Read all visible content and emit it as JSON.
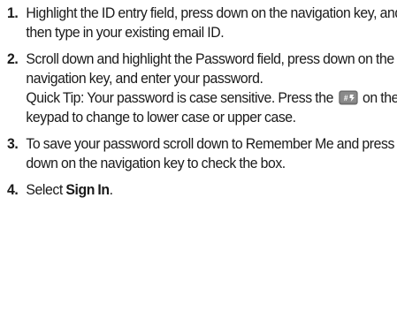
{
  "steps": [
    {
      "number": "1.",
      "text": "Highlight the ID entry field, press down on the navigation key, and then type in your existing email ID."
    },
    {
      "number": "2.",
      "text": "Scroll down and highlight the Password field, press down on the navigation key, and enter your password.",
      "tip_line1": "Quick Tip: Your password is case sensitive. Press",
      "tip_before_icon": "the",
      "tip_icon": "pound-shift-key-icon",
      "tip_after_icon": "on the keypad to change to lower case or upper case."
    },
    {
      "number": "3.",
      "text": "To save your password scroll down to Remember Me and press down on the navigation key to check the box."
    },
    {
      "number": "4.",
      "text_before": "Select",
      "text_bold": "Sign In",
      "text_after": "."
    }
  ]
}
